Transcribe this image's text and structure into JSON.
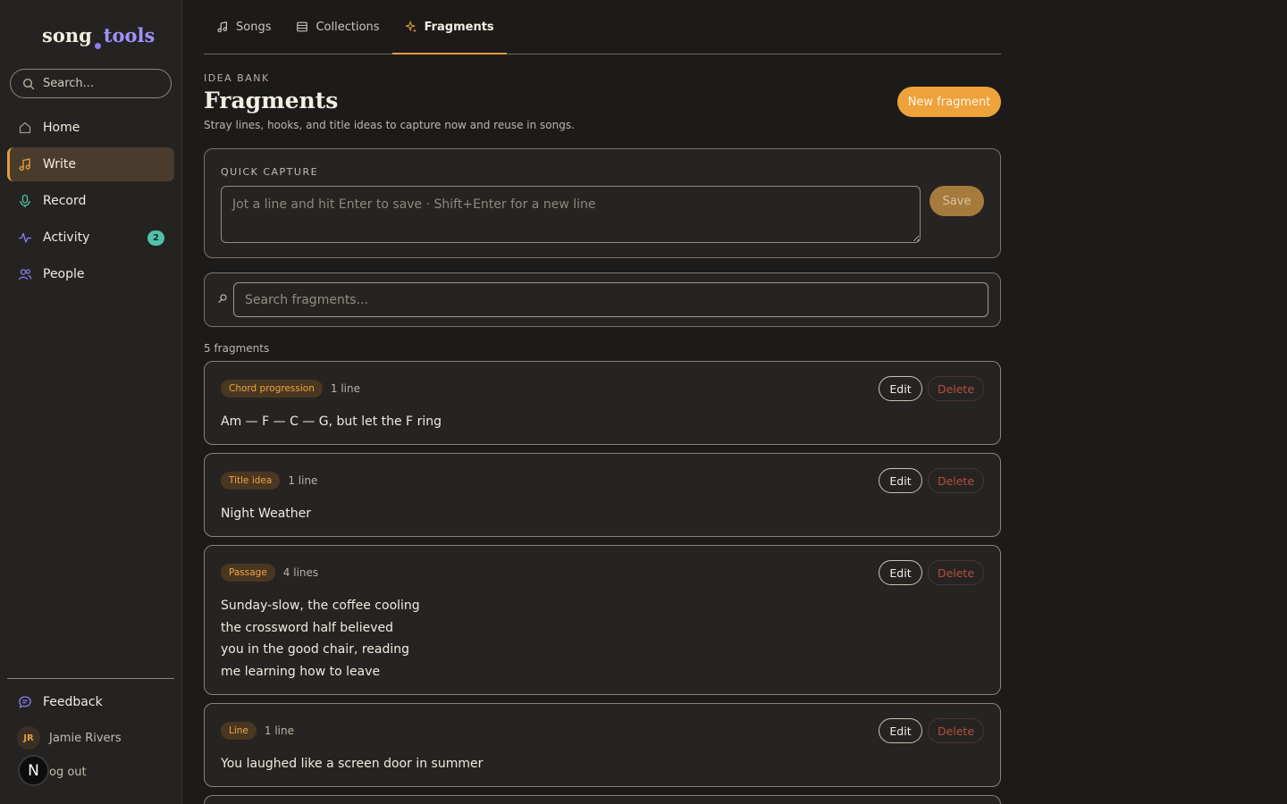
{
  "brand": {
    "word1": "song",
    "word2": "tools"
  },
  "sidebar": {
    "search_placeholder": "Search...",
    "items": [
      {
        "label": "Home",
        "icon": "home-icon"
      },
      {
        "label": "Write",
        "icon": "music-note-icon",
        "active": true
      },
      {
        "label": "Record",
        "icon": "microphone-icon"
      },
      {
        "label": "Activity",
        "icon": "activity-icon",
        "badge": "2"
      },
      {
        "label": "People",
        "icon": "people-icon"
      }
    ],
    "feedback_label": "Feedback",
    "user": {
      "initials": "JR",
      "name": "Jamie Rivers"
    },
    "logout_label": "og out",
    "fab_label": "N"
  },
  "tabs": [
    {
      "label": "Songs",
      "icon": "music-note-icon"
    },
    {
      "label": "Collections",
      "icon": "collections-icon"
    },
    {
      "label": "Fragments",
      "icon": "sparkle-icon",
      "active": true
    }
  ],
  "header": {
    "eyebrow": "IDEA BANK",
    "title": "Fragments",
    "subtitle": "Stray lines, hooks, and title ideas to capture now and reuse in songs.",
    "new_button": "New fragment"
  },
  "quick_capture": {
    "label": "QUICK CAPTURE",
    "placeholder": "Jot a line and hit Enter to save · Shift+Enter for a new line",
    "save_label": "Save"
  },
  "search": {
    "placeholder": "Search fragments..."
  },
  "count_label": "5 fragments",
  "fragments": [
    {
      "tag": "Chord progression",
      "lines": "1 line",
      "text": [
        "Am — F — C — G, but let the F ring"
      ],
      "edit": "Edit",
      "delete": "Delete"
    },
    {
      "tag": "Title idea",
      "lines": "1 line",
      "text": [
        "Night Weather"
      ],
      "edit": "Edit",
      "delete": "Delete"
    },
    {
      "tag": "Passage",
      "lines": "4 lines",
      "text": [
        "Sunday-slow, the coffee cooling",
        "the crossword half believed",
        "you in the good chair, reading",
        "me learning how to leave"
      ],
      "edit": "Edit",
      "delete": "Delete"
    },
    {
      "tag": "Line",
      "lines": "1 line",
      "text": [
        "You laughed like a screen door in summer"
      ],
      "edit": "Edit",
      "delete": "Delete"
    }
  ],
  "colors": {
    "accent": "#e39c3d",
    "badge": "#4fc2a8",
    "brand_purple": "#a191ff",
    "danger": "#b3503c"
  }
}
